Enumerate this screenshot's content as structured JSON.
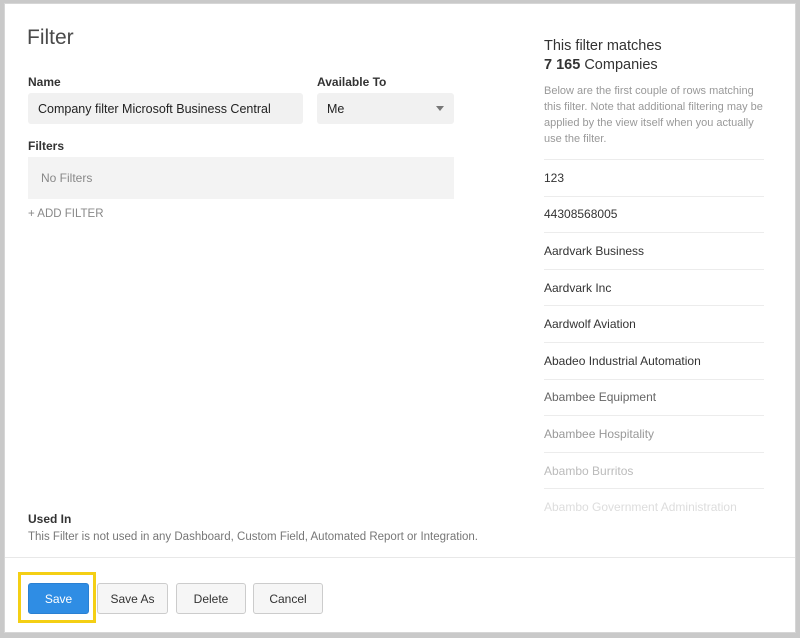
{
  "dialog": {
    "title": "Filter",
    "name_label": "Name",
    "name_value": "Company filter Microsoft Business Central",
    "available_label": "Available To",
    "available_value": "Me",
    "filters_label": "Filters",
    "filters_empty": "No Filters",
    "add_filter": "+ ADD FILTER",
    "used_in_label": "Used In",
    "used_in_text": "This Filter is not used in any Dashboard, Custom Field, Automated Report or Integration."
  },
  "matches": {
    "heading": "This filter matches",
    "count": "7 165",
    "unit": "Companies",
    "note": "Below are the first couple of rows matching this filter. Note that additional filtering may be applied by the view itself when you actually use the filter.",
    "rows": [
      "123",
      "44308568005",
      "Aardvark Business",
      "Aardvark Inc",
      "Aardwolf Aviation",
      "Abadeo Industrial Automation",
      "Abambee Equipment",
      "Abambee Hospitality",
      "Abambo Burritos",
      "Abambo Government Administration"
    ],
    "row_colors": [
      "#333333",
      "#333333",
      "#333333",
      "#333333",
      "#333333",
      "#333333",
      "#666666",
      "#999999",
      "#bbbbbb",
      "#dddddd"
    ]
  },
  "buttons": {
    "save": "Save",
    "save_as": "Save As",
    "delete": "Delete",
    "cancel": "Cancel"
  },
  "colors": {
    "primary": "#2f8de4",
    "highlight": "#f4cf14"
  }
}
